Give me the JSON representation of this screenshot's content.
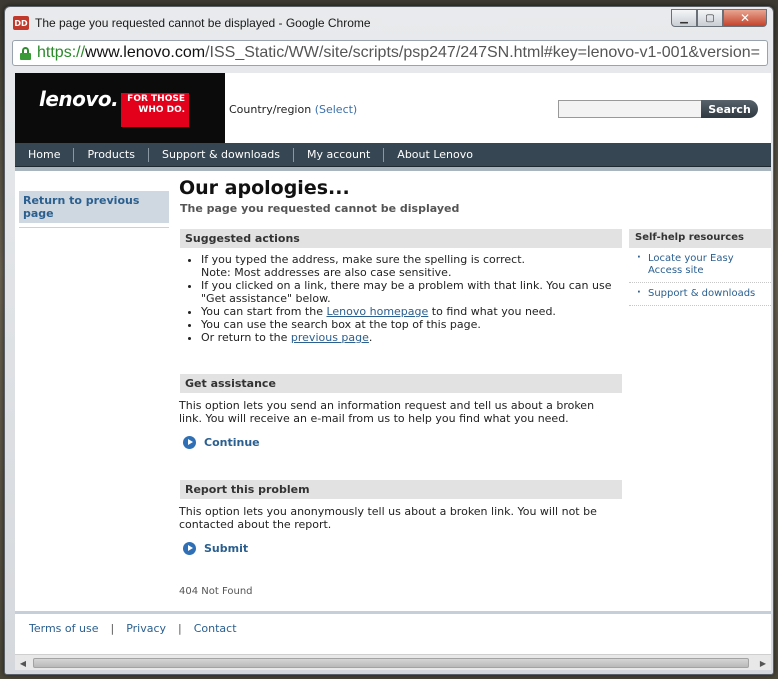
{
  "window": {
    "title": "The page you requested cannot be displayed - Google Chrome",
    "icon_text": "DD",
    "controls": {
      "minimize": "▁",
      "maximize": "▢",
      "close": "✕"
    }
  },
  "address_bar": {
    "scheme": "https://",
    "host": "www.lenovo.com",
    "path": "/ISS_Static/WW/site/scripts/psp247/247SN.html#key=lenovo-v1-001&version="
  },
  "header": {
    "logo_text": "lenovo.",
    "logo_tag": "FOR THOSE WHO DO.",
    "country_label": "Country/region",
    "country_select": "(Select)",
    "search_placeholder": "",
    "search_button": "Search"
  },
  "nav": {
    "items": [
      "Home",
      "Products",
      "Support & downloads",
      "My account",
      "About Lenovo"
    ]
  },
  "left": {
    "return_link": "Return to previous page"
  },
  "main": {
    "title": "Our apologies...",
    "subtitle": "The page you requested cannot be displayed",
    "suggested": {
      "heading": "Suggested actions",
      "item1_a": "If you typed the address, make sure the spelling is correct.",
      "item1_b": "Note: Most addresses are also case sensitive.",
      "item2": "If you clicked on a link, there may be a problem with that link. You can use \"Get assistance\" below.",
      "item3_pre": "You can start from the ",
      "item3_link": "Lenovo homepage",
      "item3_post": " to find what you need.",
      "item4": "You can use the search box at the top of this page.",
      "item5_pre": "Or return to the ",
      "item5_link": "previous page",
      "item5_post": "."
    },
    "assistance": {
      "heading": "Get assistance",
      "text": "This option lets you send an information request and tell us about a broken link. You will receive an e-mail from us to help you find what you need.",
      "action": "Continue"
    },
    "report": {
      "heading": "Report this problem",
      "text": "This option lets you anonymously tell us about a broken link. You will not be contacted about the report.",
      "action": "Submit"
    },
    "status": "404 Not Found"
  },
  "selfhelp": {
    "heading": "Self-help resources",
    "items": [
      "Locate your Easy Access site",
      "Support & downloads"
    ]
  },
  "footer": {
    "links": [
      "Terms of use",
      "Privacy",
      "Contact"
    ],
    "separator": "|"
  },
  "scrollbar": {
    "left": "◀",
    "right": "▶"
  }
}
